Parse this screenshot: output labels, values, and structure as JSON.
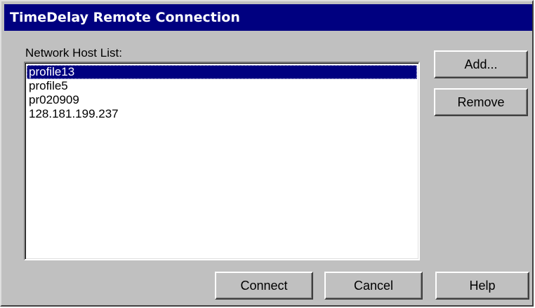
{
  "window": {
    "title": "TimeDelay Remote Connection"
  },
  "host_list": {
    "label": "Network Host List:",
    "items": [
      "profile13",
      "profile5",
      "pr020909",
      "128.181.199.237"
    ],
    "selected": "profile13"
  },
  "buttons": {
    "add": "Add...",
    "remove": "Remove",
    "connect": "Connect",
    "cancel": "Cancel",
    "help": "Help"
  },
  "colors": {
    "titlebar": "#000080",
    "face": "#c0c0c0",
    "selection": "#000080"
  }
}
